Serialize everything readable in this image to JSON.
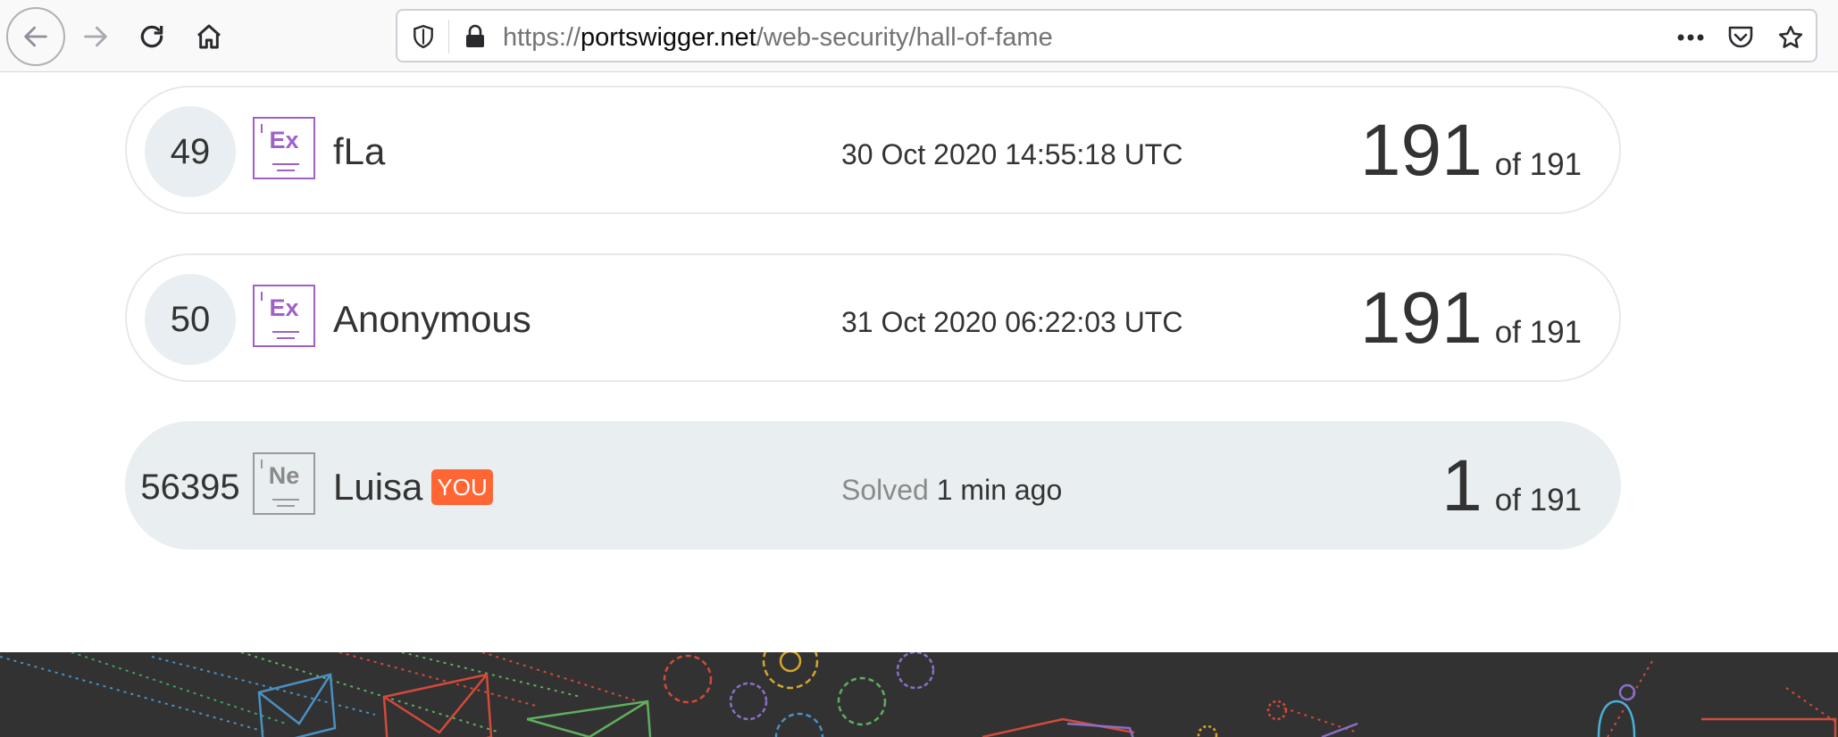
{
  "browser": {
    "url": {
      "scheme": "https://",
      "host": "portswigger.net",
      "path": "/web-security/hall-of-fame"
    },
    "icons": [
      "back-icon",
      "forward-icon",
      "reload-icon",
      "home-icon",
      "tracking-shield-icon",
      "lock-icon",
      "more-actions-icon",
      "pocket-icon",
      "bookmark-star-icon"
    ]
  },
  "leaderboard": {
    "entries": [
      {
        "rank": "49",
        "badge": "Ex",
        "name": "fLa",
        "time": "30 Oct 2020 14:55:18 UTC",
        "score": "191",
        "total": "of 191"
      },
      {
        "rank": "50",
        "badge": "Ex",
        "name": "Anonymous",
        "time": "31 Oct 2020 06:22:03 UTC",
        "score": "191",
        "total": "of 191"
      }
    ],
    "current_user": {
      "rank": "56395",
      "badge": "Ne",
      "name": "Luisa",
      "you_label": "YOU",
      "solved_label": "Solved",
      "solved_time": "1 min ago",
      "score": "1",
      "total": "of 191"
    }
  },
  "colors": {
    "expert_badge": "#a05fc9",
    "neutral_badge": "#9a9a9a",
    "you_badge": "#ff6633",
    "footer_bg": "#323232"
  }
}
